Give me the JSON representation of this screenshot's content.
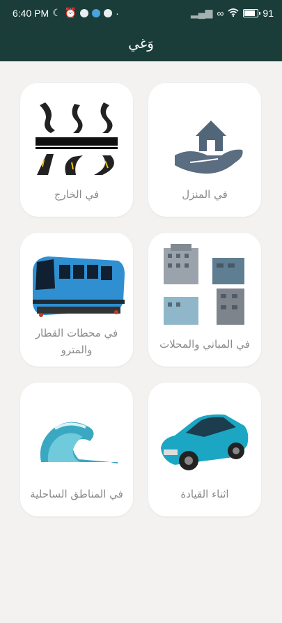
{
  "status_bar": {
    "time": "6:40 PM",
    "battery": "91",
    "battery_level": 0.91,
    "icons": [
      "moon-icon",
      "alarm-icon",
      "app-icon",
      "app-icon",
      "app-icon",
      "signal-icon",
      "sync-icon",
      "wifi-icon",
      "battery-icon"
    ]
  },
  "app_bar": {
    "title": "وَغي"
  },
  "cards": [
    {
      "id": "home",
      "label": "في المنزل",
      "icon": "house-hand-icon"
    },
    {
      "id": "outside",
      "label": "في الخارج",
      "icon": "roads-icon"
    },
    {
      "id": "buildings",
      "label": "في المباني والمحلات",
      "icon": "buildings-icon"
    },
    {
      "id": "train",
      "label": "في محطات القطار والمترو",
      "icon": "train-icon"
    },
    {
      "id": "driving",
      "label": "اثناء القيادة",
      "icon": "car-icon"
    },
    {
      "id": "coastal",
      "label": "في المناطق الساحلية",
      "icon": "wave-icon"
    }
  ],
  "colors": {
    "header": "#1a3d3a",
    "background": "#f3f2f1",
    "card": "#ffffff",
    "label": "#8a8a8a"
  }
}
